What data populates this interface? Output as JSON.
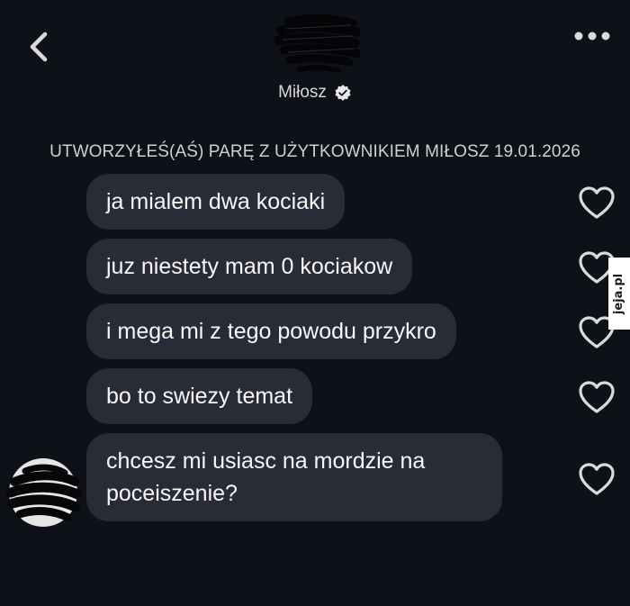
{
  "header": {
    "contact_name": "Miłosz",
    "icons": {
      "back": "chevron-left-icon",
      "more": "more-horizontal-icon",
      "verified": "verified-badge-icon",
      "avatar": "scribbled-profile-photo"
    }
  },
  "conversation": {
    "match_notice": "UTWORZYŁEŚ(AŚ) PARĘ Z UŻYTKOWNIKIEM MIŁOSZ 19.01.2026",
    "messages": [
      {
        "text": "ja mialem dwa kociaki",
        "liked": false
      },
      {
        "text": "juz niestety mam 0 kociakow",
        "liked": false
      },
      {
        "text": "i mega mi z tego powodu przykro",
        "liked": false
      },
      {
        "text": "bo to swiezy temat",
        "liked": false
      },
      {
        "text": "chcesz mi usiasc na mordzie na poceiszenie?",
        "liked": false
      }
    ]
  },
  "watermark": {
    "text": "jeja.pl",
    "accent_color": "#e0372a"
  },
  "colors": {
    "background": "#0f1118",
    "bubble": "#292b36",
    "text": "#f7f7f8"
  }
}
